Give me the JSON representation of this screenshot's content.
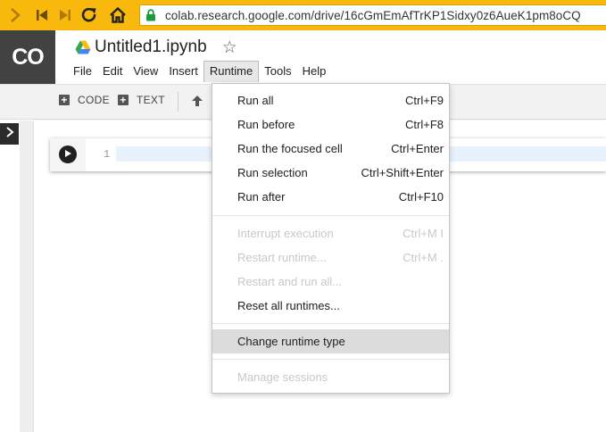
{
  "browser": {
    "url": "colab.research.google.com/drive/16cGmEmAfTrKP1Sidxy0z6AueK1pm8oCQ",
    "accent_color": "#f9b90c"
  },
  "app": {
    "logo_text": "CO",
    "notebook_title": "Untitled1.ipynb"
  },
  "menubar": {
    "items": [
      "File",
      "Edit",
      "View",
      "Insert",
      "Runtime",
      "Tools",
      "Help"
    ],
    "active": "Runtime"
  },
  "toolbar": {
    "code_label": "CODE",
    "text_label": "TEXT"
  },
  "cell": {
    "line_number": "1"
  },
  "runtime_menu": {
    "group1": [
      {
        "label": "Run all",
        "shortcut": "Ctrl+F9"
      },
      {
        "label": "Run before",
        "shortcut": "Ctrl+F8"
      },
      {
        "label": "Run the focused cell",
        "shortcut": "Ctrl+Enter"
      },
      {
        "label": "Run selection",
        "shortcut": "Ctrl+Shift+Enter"
      },
      {
        "label": "Run after",
        "shortcut": "Ctrl+F10"
      }
    ],
    "group2": [
      {
        "label": "Interrupt execution",
        "shortcut": "Ctrl+M I",
        "disabled": true
      },
      {
        "label": "Restart runtime...",
        "shortcut": "Ctrl+M .",
        "disabled": true
      },
      {
        "label": "Restart and run all...",
        "shortcut": "",
        "disabled": true
      },
      {
        "label": "Reset all runtimes...",
        "shortcut": "",
        "disabled": false
      }
    ],
    "group3": [
      {
        "label": "Change runtime type",
        "shortcut": "",
        "highlighted": true
      }
    ],
    "group4": [
      {
        "label": "Manage sessions",
        "shortcut": "",
        "disabled": true
      }
    ]
  }
}
